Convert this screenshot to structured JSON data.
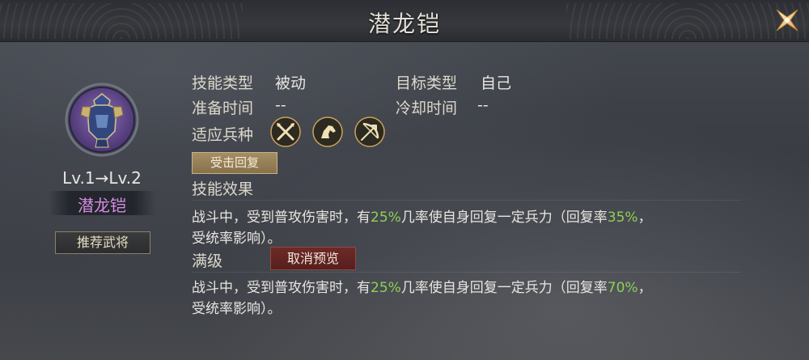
{
  "header": {
    "title": "潜龙铠",
    "close_icon": "close-x-icon"
  },
  "item": {
    "level": "Lv.1→Lv.2",
    "name": "潜龙铠",
    "name_color": "#d58ce0",
    "recommend_label": "推荐武将"
  },
  "info": {
    "skill_type_label": "技能类型",
    "skill_type_value": "被动",
    "target_type_label": "目标类型",
    "target_type_value": "自己",
    "prep_time_label": "准备时间",
    "prep_time_value": "--",
    "cooldown_label": "冷却时间",
    "cooldown_value": "--",
    "troop_label": "适应兵种",
    "troop_icons": [
      "crossed-spears-icon",
      "horse-head-icon",
      "bow-arrow-icon"
    ]
  },
  "effect": {
    "tag_label": "受击回复",
    "section_title": "技能效果",
    "desc_line1_a": "战斗中，受到普攻伤害时，有",
    "desc_line1_pct": "25%",
    "desc_line1_b": "几率使自身回复一定兵力（回复率",
    "desc_line1_rate": "35%",
    "desc_line1_c": "，",
    "desc_line2": "受统率影响）。"
  },
  "max_level": {
    "section_title": "满级",
    "cancel_preview_label": "取消预览",
    "desc_line1_a": "战斗中，受到普攻伤害时，有",
    "desc_line1_pct": "25%",
    "desc_line1_b": "几率使自身回复一定兵力（回复率",
    "desc_line1_rate": "70%",
    "desc_line1_c": "，",
    "desc_line2": "受统率影响）。"
  },
  "colors": {
    "highlight": "#8fcf56",
    "gold": "#c9a45a"
  }
}
